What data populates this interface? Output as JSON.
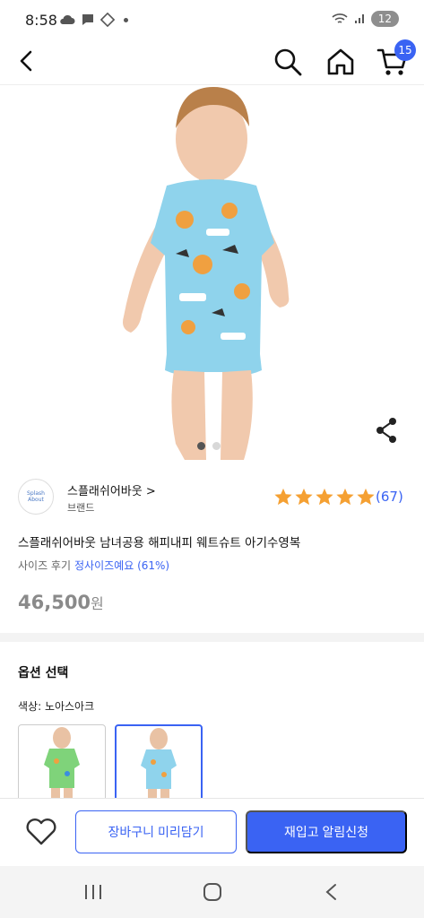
{
  "status": {
    "time": "8:58",
    "battery": "12"
  },
  "header": {
    "cart_count": "15"
  },
  "brand": {
    "logo_text": "Splash About",
    "name": "스플래쉬어바웃 >",
    "sub": "브랜드"
  },
  "rating": {
    "stars": 5,
    "count": "(67)"
  },
  "product": {
    "title": "스플래쉬어바웃 남녀공용 해피내피 웨트슈트 아기수영복",
    "size_label": "사이즈 후기",
    "size_fit": "정사이즈예요 (61%)",
    "price": "46,500",
    "currency": "원"
  },
  "carousel": {
    "count": 2,
    "active": 1
  },
  "options": {
    "title": "옵션 선택",
    "color_label": "색상: 노아스아크"
  },
  "actions": {
    "cart_label": "장바구니 미리담기",
    "restock_label": "재입고 알림신청"
  },
  "colors": {
    "accent": "#3a63f3",
    "star": "#f5a032",
    "suit": "#8fd3ec"
  }
}
